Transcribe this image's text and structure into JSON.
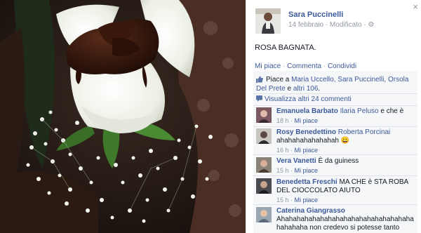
{
  "post": {
    "author": "Sara Puccinelli",
    "meta": "14 febbraio · Modificato ·",
    "caption": "ROSA BAGNATA.",
    "close_glyph": "×",
    "globe_glyph": "⚙"
  },
  "actions": {
    "like": "Mi piace",
    "sep1": " · ",
    "comment": "Commenta",
    "sep2": " · ",
    "share": "Condividi"
  },
  "likes": {
    "prefix": "Piace a ",
    "names": "Maria Uccello, Sara Puccinelli, Orsola Del Prete",
    "middle": " e ",
    "others": "altri 106",
    "suffix": "."
  },
  "view_more": "Visualizza altri 24 commenti",
  "comments": [
    {
      "name": "Emanuela Barbato",
      "tag": "Ilaria Peluso",
      "text": " e che è",
      "time": "18 h",
      "like": "Mi piace"
    },
    {
      "name": "Rosy Benedettino",
      "tag": "Roberta Porcinai",
      "text": "ahahahahahahahah 😀",
      "time": "16 h",
      "like": "Mi piace"
    },
    {
      "name": "Vera Vanetti",
      "tag": "",
      "text": "È da guiness",
      "time": "15 h",
      "like": "Mi piace"
    },
    {
      "name": "Benedetta Freschi",
      "tag": "",
      "text": "MA CHE è STA ROBA DEL CIOCCOLATO AIUTO",
      "time": "15 h",
      "like": "Mi piace"
    },
    {
      "name": "Caterina Giangrasso",
      "tag": "",
      "text": "Ahahahahahahahahahahahahahahahahahahahahaha non credevo si potesse tanto",
      "time": "",
      "like": ""
    }
  ],
  "colors": {
    "link": "#3b5998",
    "muted": "#9197a3",
    "panel": "#f6f7f9"
  }
}
